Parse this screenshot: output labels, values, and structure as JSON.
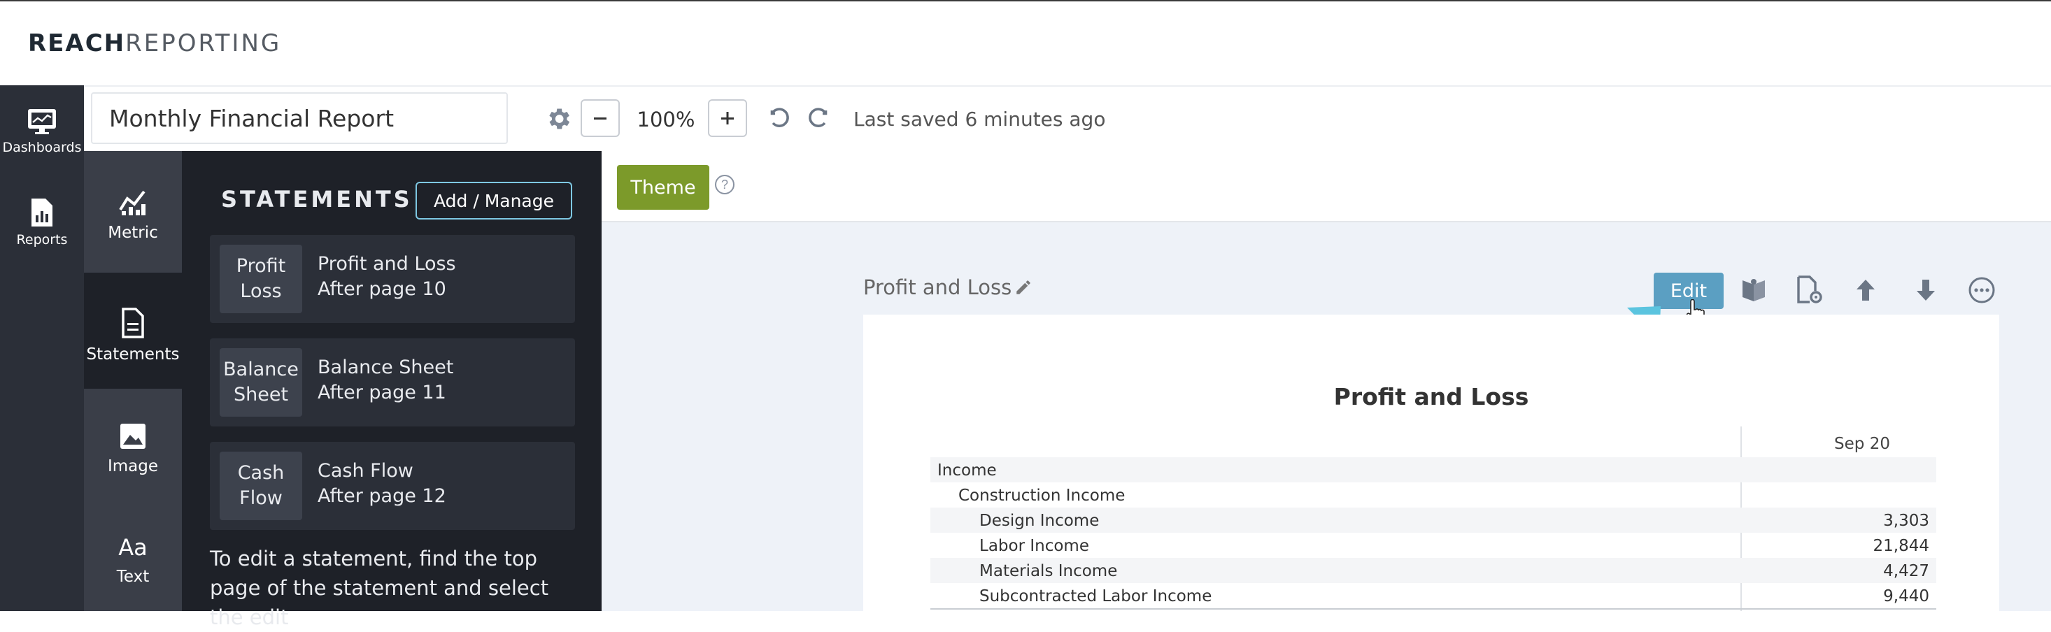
{
  "brand": {
    "bold": "REACH",
    "light": "REPORTING"
  },
  "toolbar": {
    "report_title": "Monthly Financial Report",
    "zoom": "100%",
    "zoom_out": "−",
    "zoom_in": "+",
    "saved_status": "Last saved 6 minutes ago"
  },
  "rail": {
    "items": [
      {
        "label": "Dashboards",
        "icon": "monitor-icon"
      },
      {
        "label": "Reports",
        "icon": "report-file-icon"
      }
    ]
  },
  "tabs": [
    {
      "label": "Metric",
      "icon": "metric-chart-icon"
    },
    {
      "label": "Statements",
      "icon": "document-icon",
      "active": true
    },
    {
      "label": "Image",
      "icon": "image-icon"
    },
    {
      "label": "Text",
      "icon": "text-aa-icon"
    }
  ],
  "panel": {
    "title": "STATEMENTS",
    "add_manage": "Add / Manage",
    "cards": [
      {
        "thumb_line1": "Profit",
        "thumb_line2": "Loss",
        "name": "Profit and Loss",
        "where": "After page 10"
      },
      {
        "thumb_line1": "Balance",
        "thumb_line2": "Sheet",
        "name": "Balance Sheet",
        "where": "After page 11"
      },
      {
        "thumb_line1": "Cash",
        "thumb_line2": "Flow",
        "name": "Cash Flow",
        "where": "After page 12"
      }
    ],
    "help": "To edit a statement, find the top page of the statement and select the edit"
  },
  "canvas": {
    "theme_label": "Theme",
    "help_mark": "?",
    "page_label": "Profit and Loss",
    "edit_label": "Edit",
    "statement": {
      "title": "Profit and Loss",
      "column": "Sep 20",
      "rows": [
        {
          "label": "Income",
          "value": "",
          "indent": 0,
          "shade": true
        },
        {
          "label": "Construction Income",
          "value": "",
          "indent": 1,
          "shade": false
        },
        {
          "label": "Design Income",
          "value": "3,303",
          "indent": 2,
          "shade": true
        },
        {
          "label": "Labor Income",
          "value": "21,844",
          "indent": 2,
          "shade": false
        },
        {
          "label": "Materials Income",
          "value": "4,427",
          "indent": 2,
          "shade": true
        },
        {
          "label": "Subcontracted Labor Income",
          "value": "9,440",
          "indent": 2,
          "shade": false
        }
      ]
    }
  },
  "colors": {
    "rail": "#2b2f38",
    "panel": "#1e2128",
    "theme_button": "#7c9a2a",
    "edit_button": "#5b9fc2",
    "hint_arrow": "#5bc4df"
  }
}
